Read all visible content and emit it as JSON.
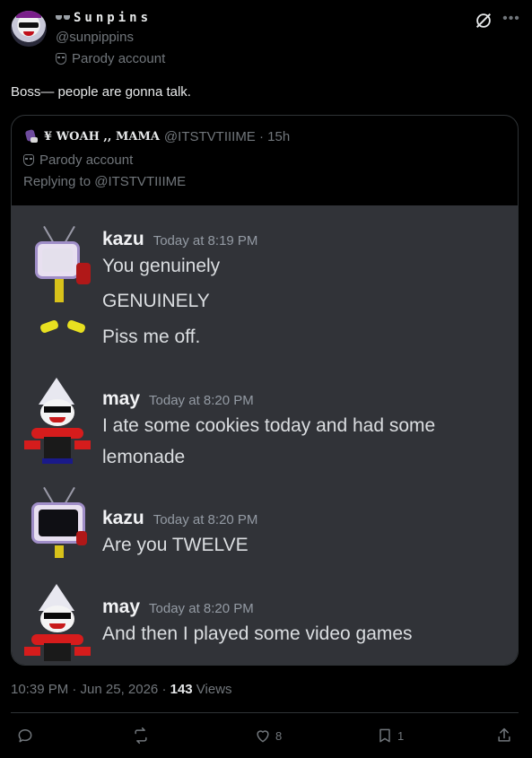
{
  "header": {
    "display_name": "Sunpins",
    "handle": "@sunpippins",
    "parody_label": "Parody account"
  },
  "tweet": {
    "text": "Boss— people are gonna talk."
  },
  "quote": {
    "display_name": "¥ WOAH ,, MAMA",
    "handle_time": "@ITSTVTIIIME · 15h",
    "parody_label": "Parody account",
    "replying_to": "Replying to @ITSTVTIIIME",
    "messages": [
      {
        "author": "kazu",
        "time": "Today at 8:19 PM",
        "lines": [
          "You genuinely",
          "GENUINELY",
          "Piss me off."
        ]
      },
      {
        "author": "may",
        "time": "Today at 8:20 PM",
        "lines": [
          "I ate some cookies today and had some",
          "lemonade"
        ]
      },
      {
        "author": "kazu",
        "time": "Today at 8:20 PM",
        "lines": [
          "Are you TWELVE"
        ]
      },
      {
        "author": "may",
        "time": "Today at 8:20 PM",
        "lines": [
          "And then I played some video games"
        ]
      }
    ]
  },
  "meta": {
    "timestamp": "10:39 PM · Jun 25, 2026 · ",
    "views_count": "143",
    "views_label": " Views"
  },
  "actions": {
    "reply_count": "",
    "repost_count": "",
    "like_count": "8",
    "bookmark_count": "1"
  },
  "colors": {
    "background": "#000000",
    "text": "#e7e9ea",
    "muted": "#71767b",
    "border": "#2f3336",
    "discord_bg": "#313338"
  }
}
